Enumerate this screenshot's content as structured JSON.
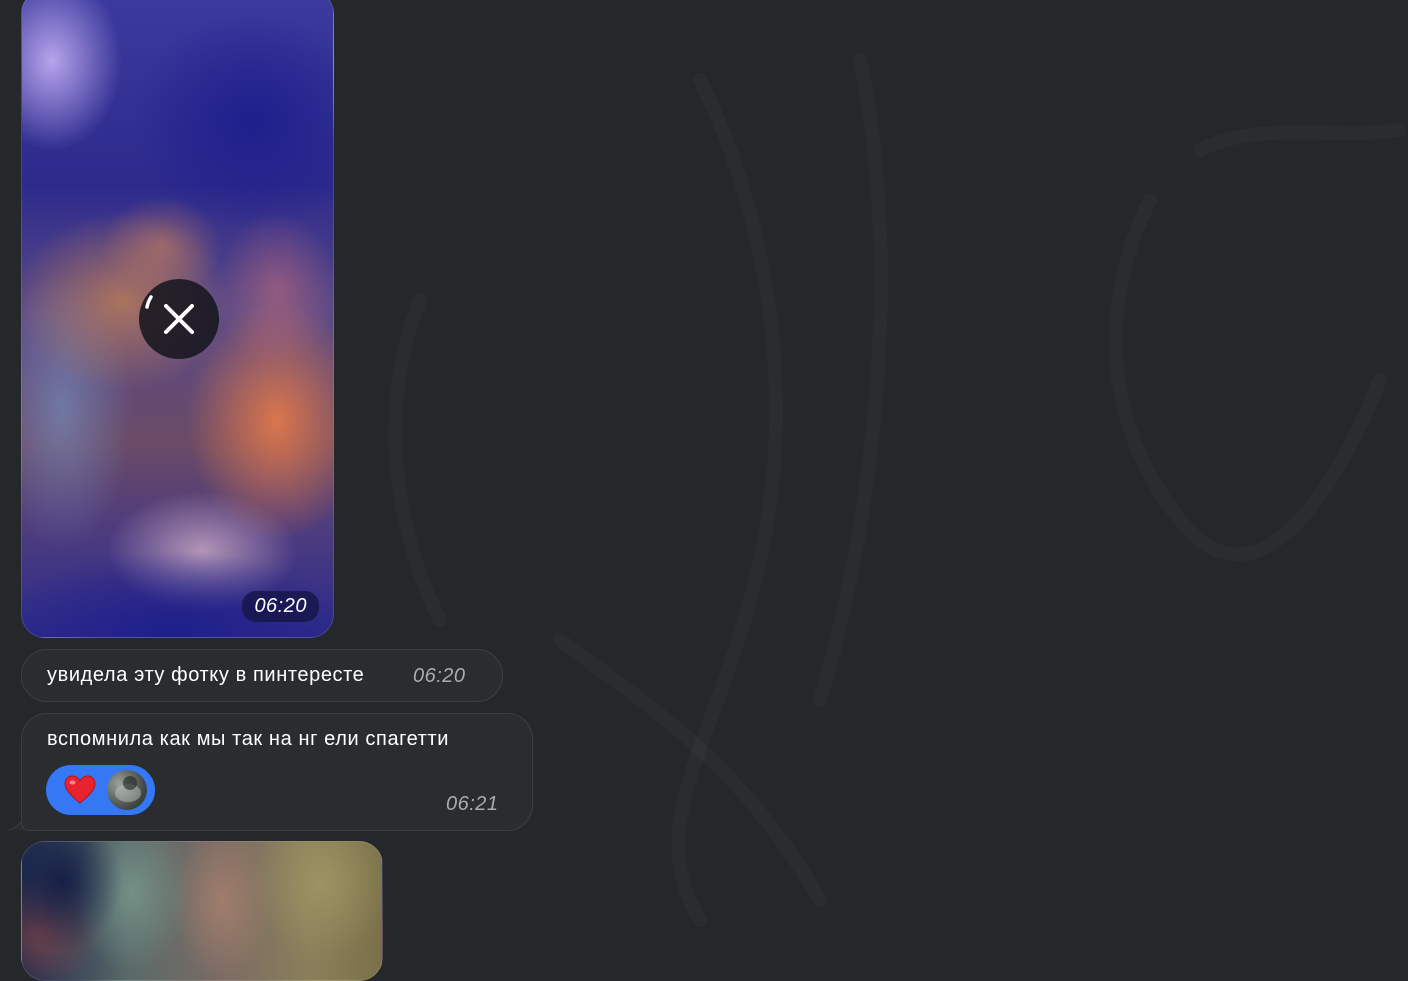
{
  "theme": {
    "background": "#25282b",
    "bubble_incoming": "#2a2c2f",
    "reaction_accent": "#3478f6",
    "time_text": "#a9acb0"
  },
  "messages": [
    {
      "type": "photo",
      "time": "06:20",
      "status_icon": "cancel-download-icon"
    },
    {
      "type": "text",
      "text": "увидела эту фотку в пинтересте",
      "time": "06:20"
    },
    {
      "type": "text",
      "text": "вспомнила как мы так на нг ели спагетти",
      "time": "06:21",
      "reaction": {
        "emoji": "heart-icon",
        "avatar": "avatar"
      }
    },
    {
      "type": "photo",
      "time": ""
    }
  ]
}
